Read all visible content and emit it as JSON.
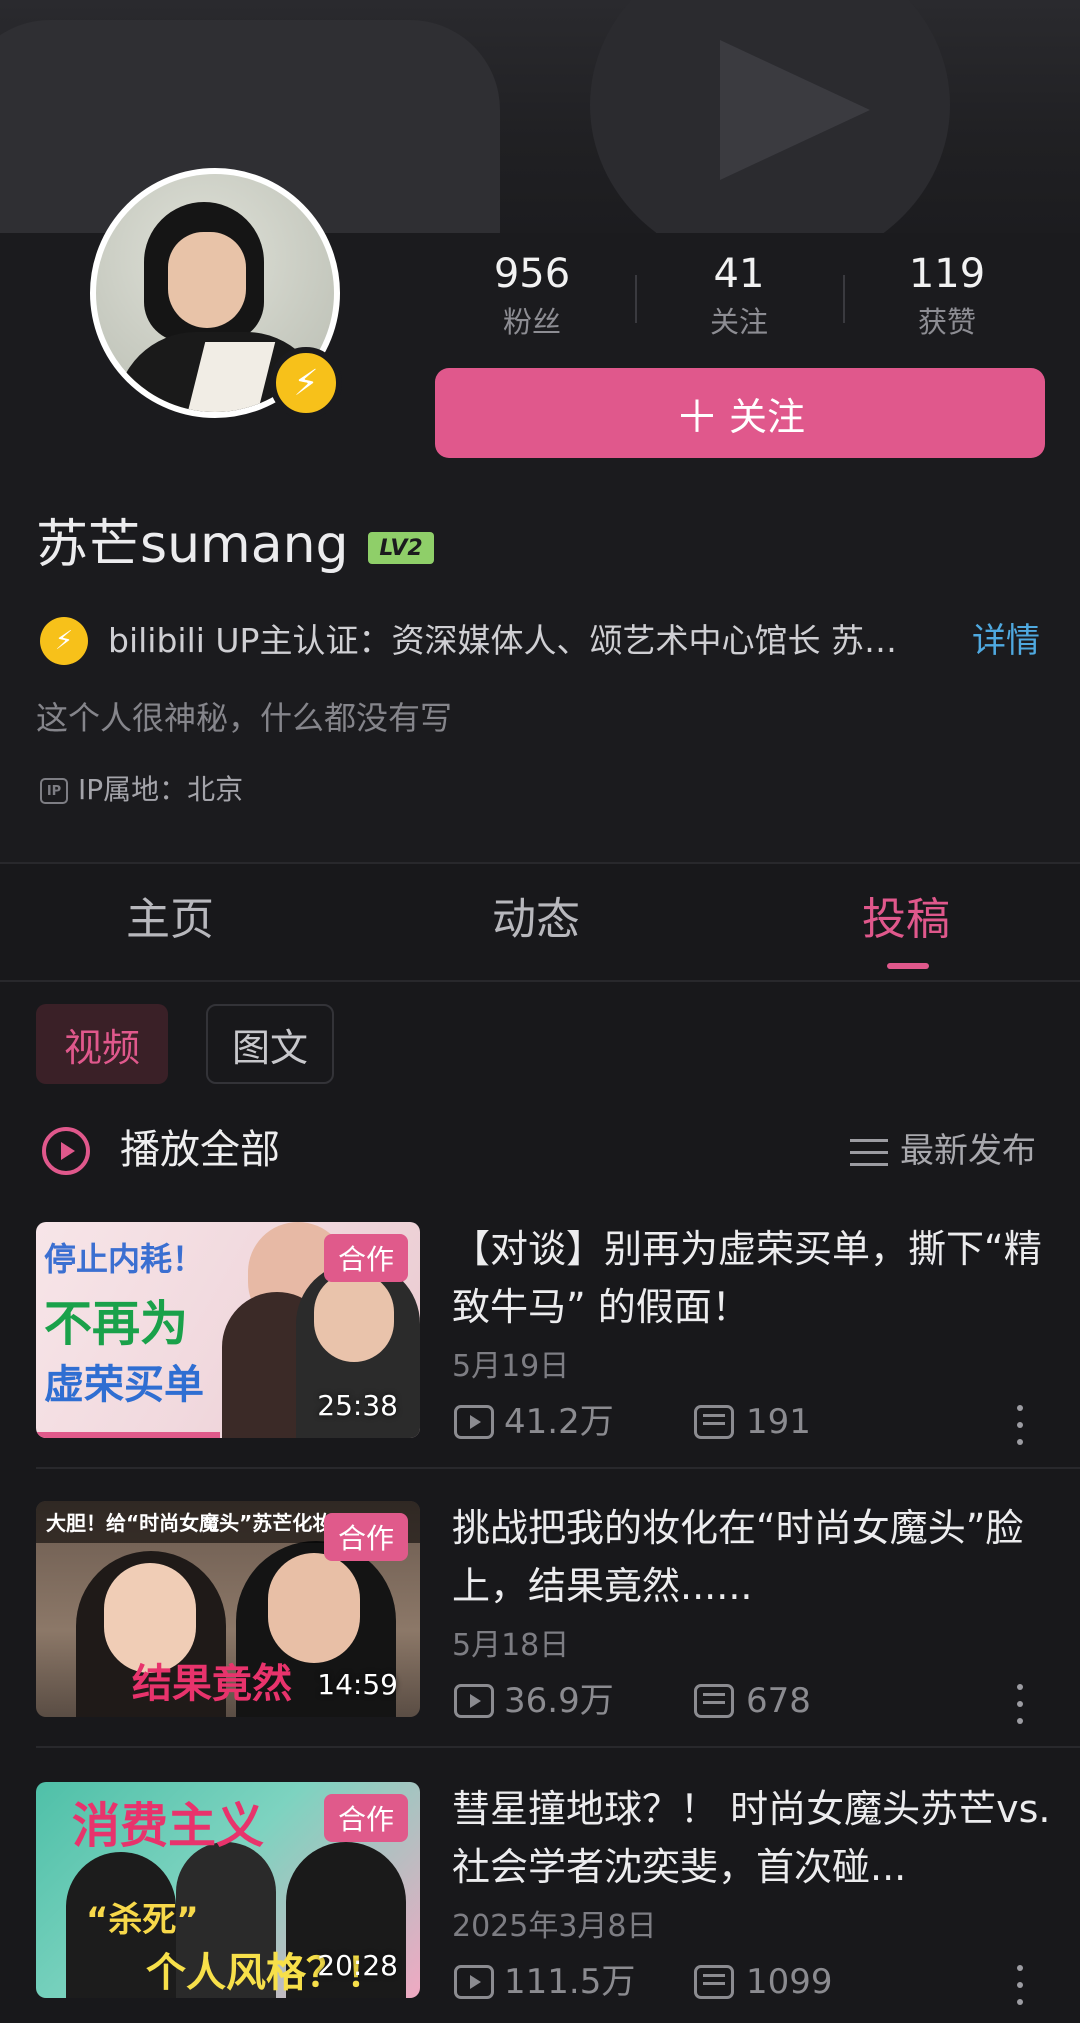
{
  "profile": {
    "stats": [
      {
        "value": "956",
        "label": "粉丝"
      },
      {
        "value": "41",
        "label": "关注"
      },
      {
        "value": "119",
        "label": "获赞"
      }
    ],
    "follow_button": {
      "icon": "plus-icon",
      "label": "关注",
      "color": "#e0588c"
    },
    "username": "苏芒sumang",
    "level_badge": "LV2",
    "verification": "bilibili UP主认证：资深媒体人、颂艺术中心馆长 苏…",
    "verification_detail_link": "详情",
    "bio": "这个人很神秘，什么都没有写",
    "ip_icon_text": "IP",
    "ip_location": "IP属地：北京"
  },
  "tabs": [
    {
      "label": "主页",
      "active": false
    },
    {
      "label": "动态",
      "active": false
    },
    {
      "label": "投稿",
      "active": true
    }
  ],
  "filters": [
    {
      "label": "视频",
      "selected": true
    },
    {
      "label": "图文",
      "selected": false
    }
  ],
  "list_header": {
    "play_all": "播放全部",
    "sort": "最新发布"
  },
  "videos": [
    {
      "title": "【对谈】别再为虚荣买单，撕下“精致牛马” 的假面！",
      "date": "5月19日",
      "views": "41.2万",
      "danmaku": "191",
      "duration": "25:38",
      "tag": "合作",
      "watched_fraction": 0.48,
      "thumb_text": [
        "停止内耗！",
        "不再为",
        "虚荣买单"
      ]
    },
    {
      "title": "挑战把我的妆化在“时尚女魔头”脸上，结果竟然......",
      "date": "5月18日",
      "views": "36.9万",
      "danmaku": "678",
      "duration": "14:59",
      "tag": "合作",
      "thumb_text": [
        "大胆！给“时尚女魔头”苏芒化妆",
        "结果竟然"
      ]
    },
    {
      "title": "彗星撞地球？！ 时尚女魔头苏芒vs.社会学者沈奕斐，首次碰...",
      "date": "2025年3月8日",
      "views": "111.5万",
      "danmaku": "1099",
      "duration": "20:28",
      "tag": "合作",
      "thumb_text": [
        "消费主义",
        "“杀死”",
        "个人风格？！"
      ]
    }
  ]
}
